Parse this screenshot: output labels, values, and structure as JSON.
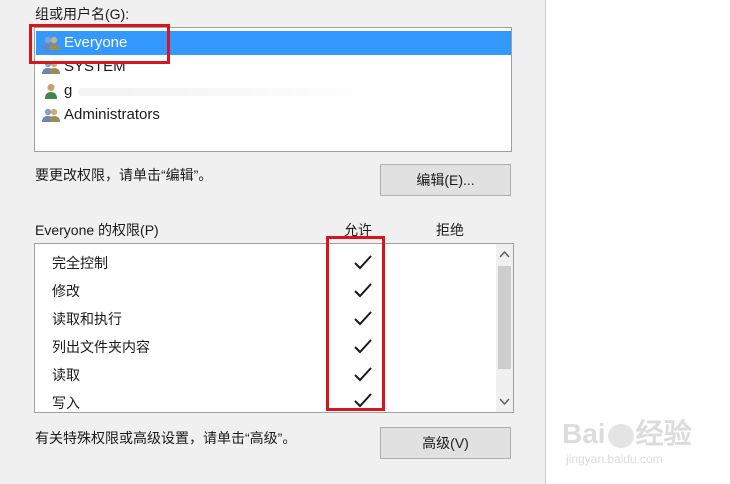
{
  "groups_label": "组或用户名(G):",
  "groups": [
    {
      "name": "Everyone",
      "selected": true,
      "icon": "user-group-icon"
    },
    {
      "name": "SYSTEM",
      "selected": false,
      "icon": "user-group-icon"
    },
    {
      "name": "g",
      "selected": false,
      "icon": "single-user-icon"
    },
    {
      "name": "Administrators",
      "selected": false,
      "icon": "user-group-icon"
    }
  ],
  "edit_hint": "要更改权限，请单击“编辑”。",
  "edit_button": "编辑(E)...",
  "permissions_label": "Everyone 的权限(P)",
  "allow_header": "允许",
  "deny_header": "拒绝",
  "permissions": [
    {
      "name": "完全控制",
      "allow": true,
      "deny": false
    },
    {
      "name": "修改",
      "allow": true,
      "deny": false
    },
    {
      "name": "读取和执行",
      "allow": true,
      "deny": false
    },
    {
      "name": "列出文件夹内容",
      "allow": true,
      "deny": false
    },
    {
      "name": "读取",
      "allow": true,
      "deny": false
    },
    {
      "name": "写入",
      "allow": true,
      "deny": false
    }
  ],
  "advanced_hint": "有关特殊权限或高级设置，请单击“高级”。",
  "advanced_button": "高级(V)",
  "watermark": {
    "logo": "Bai",
    "logo_suffix": "经验",
    "url": "jingyan.baidu.com"
  },
  "colors": {
    "selection": "#3399ff",
    "highlight": "#d8141c"
  }
}
